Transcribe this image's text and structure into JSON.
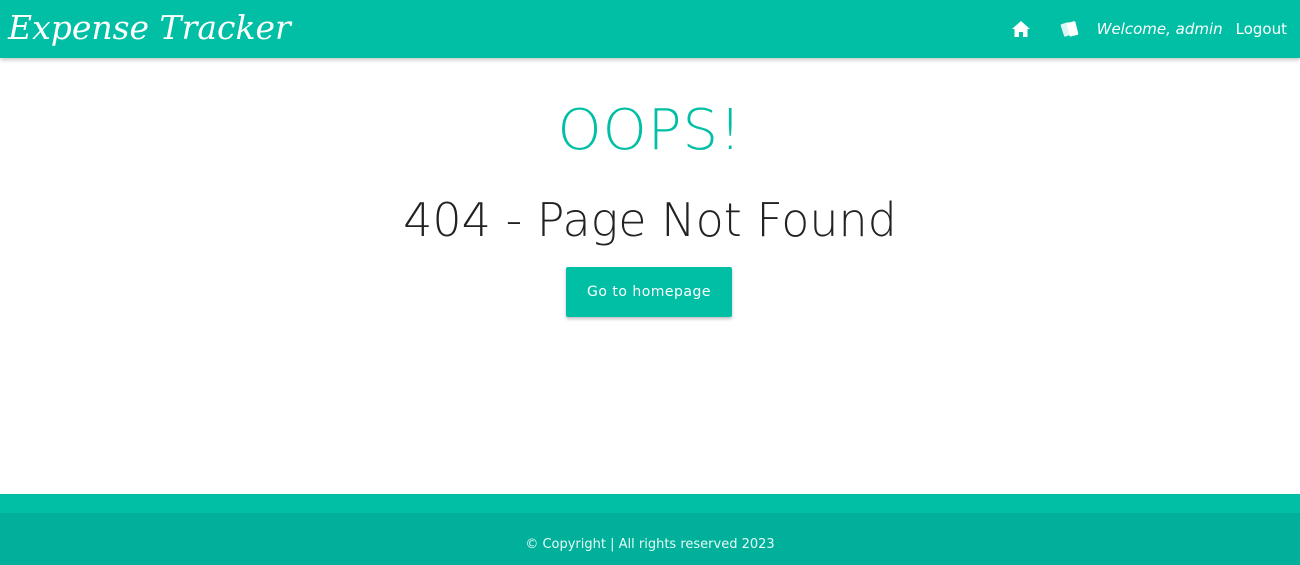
{
  "app": {
    "title": "Expense Tracker"
  },
  "navbar": {
    "home_icon": "home-icon",
    "expenses_icon": "money-icon",
    "welcome_text": "Welcome, admin",
    "logout_label": "Logout"
  },
  "error": {
    "heading": "OOPS!",
    "message": "404 - Page Not Found",
    "button_label": "Go to homepage"
  },
  "footer": {
    "copyright": "© Copyright | All rights reserved 2023"
  },
  "colors": {
    "accent": "#00bfa5",
    "footer": "#00b09a",
    "text_dark": "#222222",
    "white": "#ffffff"
  }
}
